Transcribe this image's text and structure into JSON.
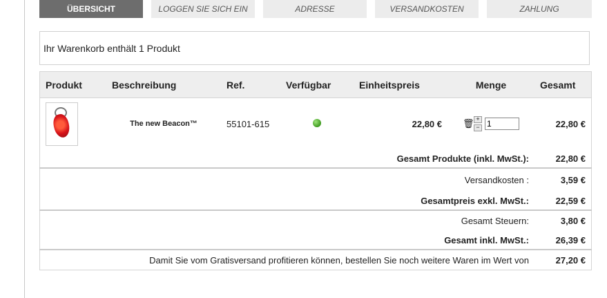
{
  "steps": [
    "ÜBERSICHT",
    "LOGGEN SIE SICH EIN",
    "ADRESSE",
    "VERSANDKOSTEN",
    "ZAHLUNG"
  ],
  "summary": "Ihr Warenkorb enthält 1 Produkt",
  "table": {
    "headers": [
      "Produkt",
      "Beschreibung",
      "Ref.",
      "Verfügbar",
      "Einheitspreis",
      "Menge",
      "Gesamt"
    ],
    "item": {
      "name": "The new Beacon™",
      "ref": "55101-615",
      "unit_price": "22,80 €",
      "quantity": "1",
      "total": "22,80 €",
      "availability_color": "#3e9a1f"
    }
  },
  "totals": {
    "products_label": "Gesamt Produkte (inkl. MwSt.):",
    "products_value": "22,80 €",
    "shipping_label": "Versandkosten :",
    "shipping_value": "3,59 €",
    "excl_label": "Gesamtpreis exkl. MwSt.:",
    "excl_value": "22,59 €",
    "tax_label": "Gesamt Steuern:",
    "tax_value": "3,80 €",
    "incl_label": "Gesamt inkl. MwSt.:",
    "incl_value": "26,39 €",
    "free_shipping_label": "Damit Sie vom Gratisversand profitieren können, bestellen Sie noch weitere Waren im Wert von",
    "free_shipping_value": "27,20 €"
  }
}
